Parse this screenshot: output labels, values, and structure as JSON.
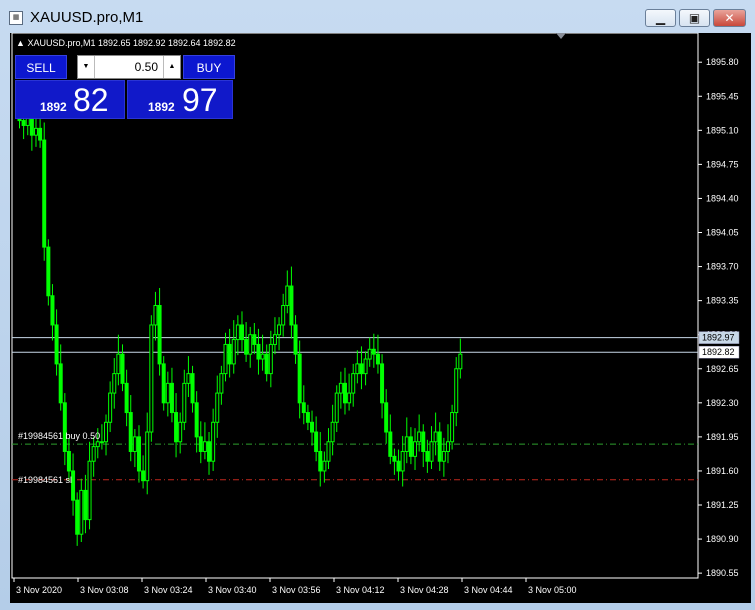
{
  "window": {
    "title": "XAUUSD.pro,M1",
    "app_icon": "mt-chart-icon",
    "controls": {
      "minimize": "▁",
      "maximize": "▣",
      "close": "✕"
    }
  },
  "chart_header": {
    "text": "XAUUSD.pro,M1  1892.65 1892.92 1892.64 1892.82",
    "symbol": "XAUUSD.pro,M1",
    "ohlc": [
      1892.65,
      1892.92,
      1892.64,
      1892.82
    ]
  },
  "trade_panel": {
    "sell_label": "SELL",
    "buy_label": "BUY",
    "lot_value": "0.50",
    "sell_big": "1892",
    "sell_small": "82",
    "buy_big": "1892",
    "buy_small": "97"
  },
  "orders": [
    {
      "label": "#19984561 buy 0.50",
      "price": 1891.875,
      "color": "#2e9e2e"
    },
    {
      "label": "#19984561 sl",
      "price": 1891.51,
      "color": "#c0281e"
    }
  ],
  "price_lines": [
    {
      "label": "1892.97",
      "price": 1892.97,
      "color": "#c8d8e8",
      "bg": "#c8d8e8"
    },
    {
      "label": "1892.82",
      "price": 1892.82,
      "color": "#c8d8e8",
      "bg": "#ffffff"
    }
  ],
  "colors": {
    "background": "#000000",
    "candle": "#00ff00",
    "axis": "#ffffff"
  },
  "chart_data": {
    "type": "candlestick",
    "ylim": [
      1890.5,
      1896.1
    ],
    "y_ticks": [
      "1895.80",
      "1895.45",
      "1895.10",
      "1894.75",
      "1894.40",
      "1894.05",
      "1893.70",
      "1893.35",
      "1893.00",
      "1892.65",
      "1892.30",
      "1891.95",
      "1891.60",
      "1891.25",
      "1890.90",
      "1890.55"
    ],
    "x_ticks": [
      "3 Nov 2020",
      "3 Nov 03:08",
      "3 Nov 03:24",
      "3 Nov 03:40",
      "3 Nov 03:56",
      "3 Nov 04:12",
      "3 Nov 04:28",
      "3 Nov 04:44",
      "3 Nov 05:00"
    ],
    "bars_per_tick": 16,
    "close_series": [
      1895.2,
      1895.15,
      1895.25,
      1895.05,
      1895.12,
      1895.0,
      1893.9,
      1893.4,
      1893.1,
      1892.7,
      1892.3,
      1891.8,
      1891.6,
      1891.3,
      1890.95,
      1891.4,
      1891.1,
      1891.7,
      1891.85,
      1891.9,
      1891.9,
      1892.1,
      1892.4,
      1892.6,
      1892.8,
      1892.5,
      1892.2,
      1891.8,
      1891.95,
      1891.6,
      1891.5,
      1892.0,
      1893.1,
      1893.3,
      1892.7,
      1892.3,
      1892.5,
      1892.2,
      1891.9,
      1892.1,
      1892.5,
      1892.6,
      1892.3,
      1891.95,
      1891.8,
      1891.9,
      1891.7,
      1892.1,
      1892.4,
      1892.6,
      1892.9,
      1892.7,
      1892.95,
      1893.1,
      1892.95,
      1892.8,
      1893.0,
      1892.9,
      1892.75,
      1892.8,
      1892.6,
      1892.9,
      1893.0,
      1893.1,
      1893.3,
      1893.5,
      1893.1,
      1892.8,
      1892.3,
      1892.2,
      1892.1,
      1892.0,
      1891.8,
      1891.6,
      1891.7,
      1891.9,
      1892.1,
      1892.4,
      1892.5,
      1892.3,
      1892.4,
      1892.6,
      1892.7,
      1892.6,
      1892.75,
      1892.85,
      1892.8,
      1892.7,
      1892.3,
      1892.0,
      1891.75,
      1891.7,
      1891.6,
      1891.8,
      1891.95,
      1891.75,
      1891.9,
      1892.0,
      1891.8,
      1891.7,
      1891.9,
      1892.0,
      1891.7,
      1891.8,
      1891.9,
      1892.2,
      1892.65,
      1892.8
    ]
  }
}
